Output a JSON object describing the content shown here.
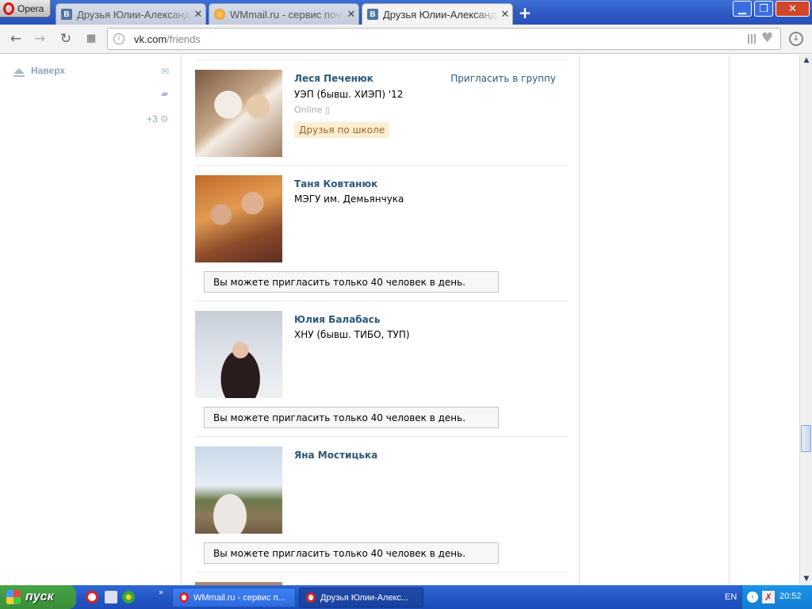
{
  "browser": {
    "app_name": "Opera",
    "tabs": [
      {
        "label": "Друзья Юлии-Александр",
        "icon": "vk-favicon",
        "active": false
      },
      {
        "label": "WMmail.ru - сервис почт",
        "icon": "wmmail-favicon",
        "active": false
      },
      {
        "label": "Друзья Юлии-Александр",
        "icon": "vk-favicon",
        "active": true
      }
    ],
    "new_tab": "+",
    "address": {
      "host": "vk.com",
      "path": "/friends"
    }
  },
  "sidebar": {
    "top_link": "Наверх",
    "counter": "+3"
  },
  "friends": [
    {
      "name": "Леся Печенюк",
      "university": "УЭП (бывш. ХИЭП) '12",
      "online": "Online",
      "tag": "Друзья по школе",
      "invite": "Пригласить в группу"
    },
    {
      "name": "Таня Ковтанюк",
      "university": "МЭГУ им. Демьянчука",
      "notice": "Вы можете пригласить только 40 человек в день."
    },
    {
      "name": "Юлия Балабась",
      "university": "ХНУ (бывш. ТИБО, ТУП)",
      "notice": "Вы можете пригласить только 40 человек в день."
    },
    {
      "name": "Яна Мостицька",
      "university": "",
      "notice": "Вы можете пригласить только 40 человек в день."
    }
  ],
  "taskbar": {
    "start_label": "пуск",
    "buttons": [
      {
        "label": "WMmail.ru - сервис п..."
      },
      {
        "label": "Друзья Юлии-Алекс..."
      }
    ],
    "lang": "EN",
    "clock": "20:52"
  },
  "colors": {
    "vk_blue": "#2b587a",
    "tag_bg": "#fbeed3",
    "titlebar": "#2d58c3"
  }
}
